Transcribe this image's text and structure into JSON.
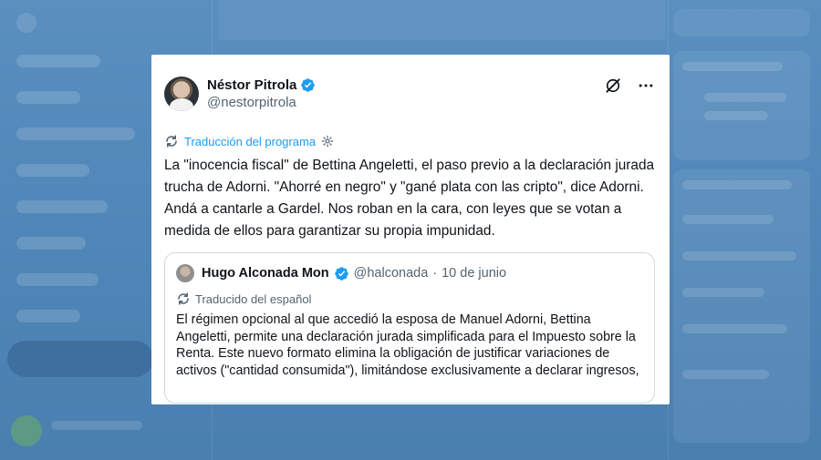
{
  "colors": {
    "accent": "#1d9bf0",
    "verified": "#1d9bf0",
    "background": "#4e86b8",
    "card": "#ffffff",
    "secondary_text": "#536471"
  },
  "icons": {
    "verified": "verified-badge-icon",
    "grok": "grok-icon",
    "more": "more-icon",
    "translate": "translate-icon",
    "settings": "gear-icon"
  },
  "tweet": {
    "author": {
      "display_name": "Néstor Pitrola",
      "handle": "@nestorpitrola"
    },
    "translation_label": "Traducción del programa",
    "text": "La \"inocencia fiscal\" de Bettina Angeletti, el paso previo a la declaración jurada trucha de Adorni. \"Ahorré en negro\" y \"gané plata con las cripto\", dice Adorni. Andá a cantarle a Gardel. Nos roban en la cara, con leyes que se votan a medida de ellos para garantizar su propia impunidad.",
    "quoted": {
      "display_name": "Hugo Alconada Mon",
      "handle": "@halconada",
      "separator": "·",
      "date": "10 de junio",
      "translation_label": "Traducido del español",
      "text": "El régimen opcional al que accedió la esposa de Manuel Adorni, Bettina Angeletti, permite una declaración jurada simplificada para el Impuesto sobre la Renta. Este nuevo formato elimina la obligación de justificar variaciones de activos (\"cantidad consumida\"), limitándose exclusivamente a declarar ingresos,"
    }
  }
}
